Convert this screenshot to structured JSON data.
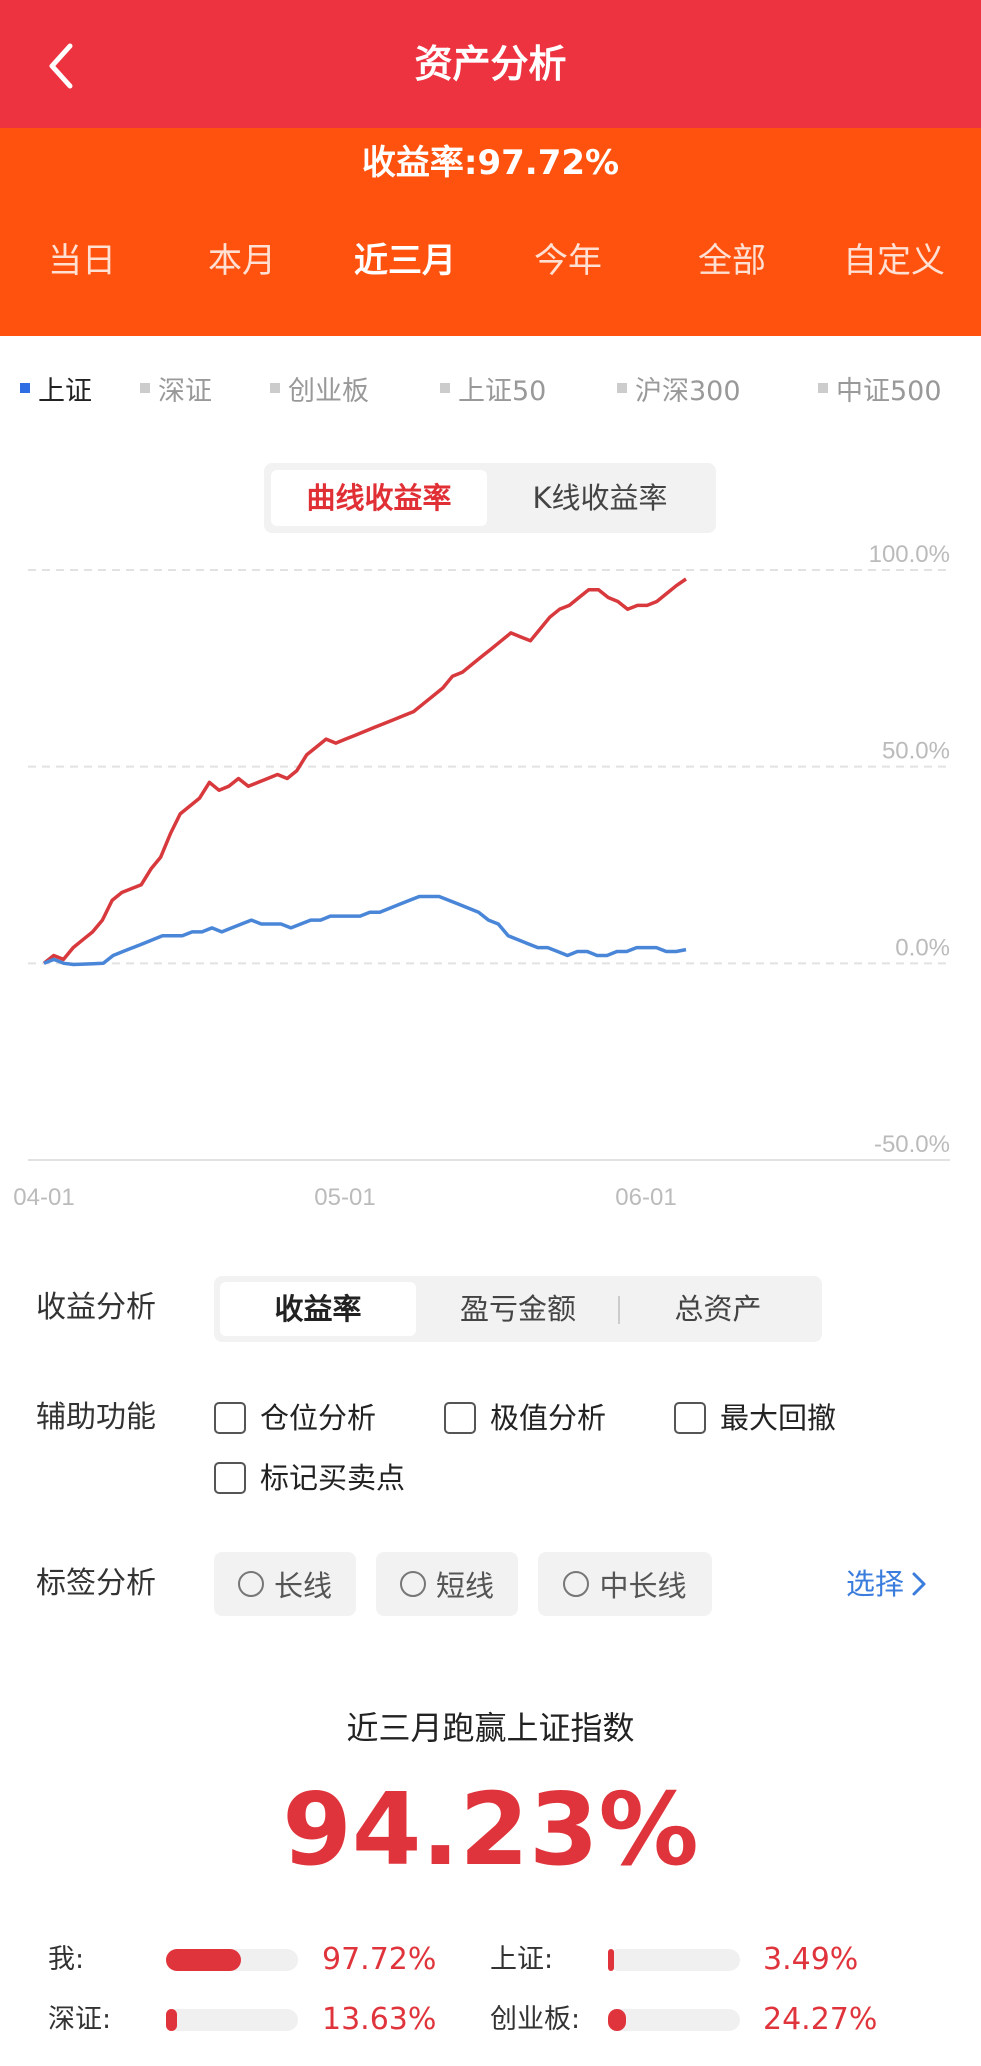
{
  "header": {
    "title": "资产分析"
  },
  "summary": {
    "rate_text": "收益率:97.72%"
  },
  "periods": [
    "当日",
    "本月",
    "近三月",
    "今年",
    "全部",
    "自定义"
  ],
  "active_period": 2,
  "indices": [
    "上证",
    "深证",
    "创业板",
    "上证50",
    "沪深300",
    "中证500"
  ],
  "active_index": 0,
  "chart_toggle": {
    "active": "曲线收益率",
    "inactive": "K线收益率"
  },
  "colors": {
    "header": "#ee3340",
    "banner": "#ff520e",
    "mine": "#d8393d",
    "index": "#4a86d8",
    "accent": "#e0343c",
    "link": "#3b7ddd"
  },
  "chart_data": {
    "type": "line",
    "x_ticks": [
      "04-01",
      "05-01",
      "06-01"
    ],
    "y_ticks": [
      "100.0%",
      "50.0%",
      "0.0%",
      "-50.0%"
    ],
    "ylim": [
      -50,
      100
    ],
    "ylabel_unit": "%",
    "grid": true,
    "series": [
      {
        "values": [
          0,
          2,
          1,
          4,
          6,
          8,
          11,
          16,
          18,
          19,
          20,
          24,
          27,
          33,
          38,
          40,
          42,
          46,
          44,
          45,
          47,
          45,
          46,
          47,
          48,
          47,
          49,
          53,
          55,
          57,
          56,
          57,
          58,
          59,
          60,
          61,
          62,
          63,
          64,
          66,
          68,
          70,
          73,
          74,
          76,
          78,
          80,
          82,
          84,
          83,
          82,
          85,
          88,
          90,
          91,
          93,
          95,
          95,
          93,
          92,
          90,
          91,
          91,
          92,
          94,
          96,
          97.72
        ]
      },
      {
        "values": [
          0,
          1,
          0,
          -0.3,
          -0.2,
          -0.1,
          0,
          2,
          3,
          4,
          5,
          6,
          7,
          7,
          7,
          8,
          8,
          9,
          8,
          9,
          10,
          11,
          10,
          10,
          10,
          9,
          10,
          11,
          11,
          12,
          12,
          12,
          12,
          13,
          13,
          14,
          15,
          16,
          17,
          17,
          17,
          16,
          15,
          14,
          13,
          11,
          10,
          7,
          6,
          5,
          4,
          4,
          3,
          2,
          3,
          3,
          2,
          2,
          3,
          3,
          4,
          4,
          4,
          3,
          3,
          3.49
        ]
      }
    ]
  },
  "analysis": {
    "label": "收益分析",
    "tabs": [
      "收益率",
      "盈亏金额",
      "总资产"
    ],
    "active_tab": 0
  },
  "aux": {
    "label": "辅助功能",
    "options": [
      "仓位分析",
      "极值分析",
      "最大回撤",
      "标记买卖点"
    ]
  },
  "tags": {
    "label": "标签分析",
    "options": [
      "长线",
      "短线",
      "中长线"
    ],
    "select_label": "选择"
  },
  "beat": {
    "title": "近三月跑赢上证指数",
    "value": "94.23%"
  },
  "comparison": [
    {
      "label": "我:",
      "value": "97.72%",
      "fraction": 0.57
    },
    {
      "label": "上证:",
      "value": "3.49%",
      "fraction": 0.03
    },
    {
      "label": "深证:",
      "value": "13.63%",
      "fraction": 0.08
    },
    {
      "label": "创业板:",
      "value": "24.27%",
      "fraction": 0.14
    }
  ]
}
